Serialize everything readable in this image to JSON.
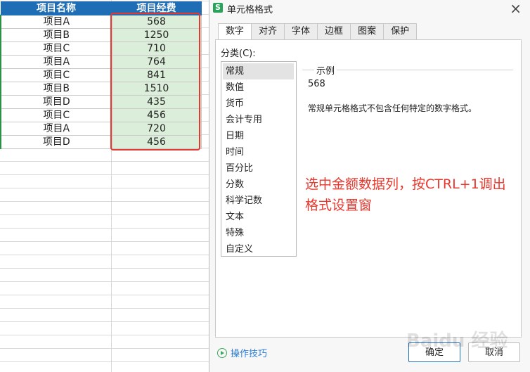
{
  "sheet": {
    "headers": [
      "项目名称",
      "项目经费"
    ],
    "rows": [
      {
        "name": "项目A",
        "value": "568"
      },
      {
        "name": "项目B",
        "value": "1250"
      },
      {
        "name": "项目C",
        "value": "710"
      },
      {
        "name": "项目A",
        "value": "764"
      },
      {
        "name": "项目C",
        "value": "841"
      },
      {
        "name": "项目B",
        "value": "1510"
      },
      {
        "name": "项目D",
        "value": "435"
      },
      {
        "name": "项目C",
        "value": "456"
      },
      {
        "name": "项目A",
        "value": "720"
      },
      {
        "name": "项目D",
        "value": "456"
      }
    ]
  },
  "dialog": {
    "app_icon": "S",
    "title": "单元格格式",
    "close": "×",
    "tabs": [
      "数字",
      "对齐",
      "字体",
      "边框",
      "图案",
      "保护"
    ],
    "category_label": "分类(C):",
    "categories": [
      "常规",
      "数值",
      "货币",
      "会计专用",
      "日期",
      "时间",
      "百分比",
      "分数",
      "科学记数",
      "文本",
      "特殊",
      "自定义"
    ],
    "sample_title": "示例",
    "sample_value": "568",
    "description": "常规单元格格式不包含任何特定的数字格式。",
    "annotation": "选中金额数据列，按CTRL+1调出格式设置窗",
    "tips": "操作技巧",
    "ok": "确定",
    "cancel": "取消"
  },
  "watermark": "Baidu 经验",
  "colors": {
    "header": "#1f6db5",
    "selected_fill": "#dbeed9",
    "annotation": "#e8372d",
    "link": "#2d7fd6"
  }
}
